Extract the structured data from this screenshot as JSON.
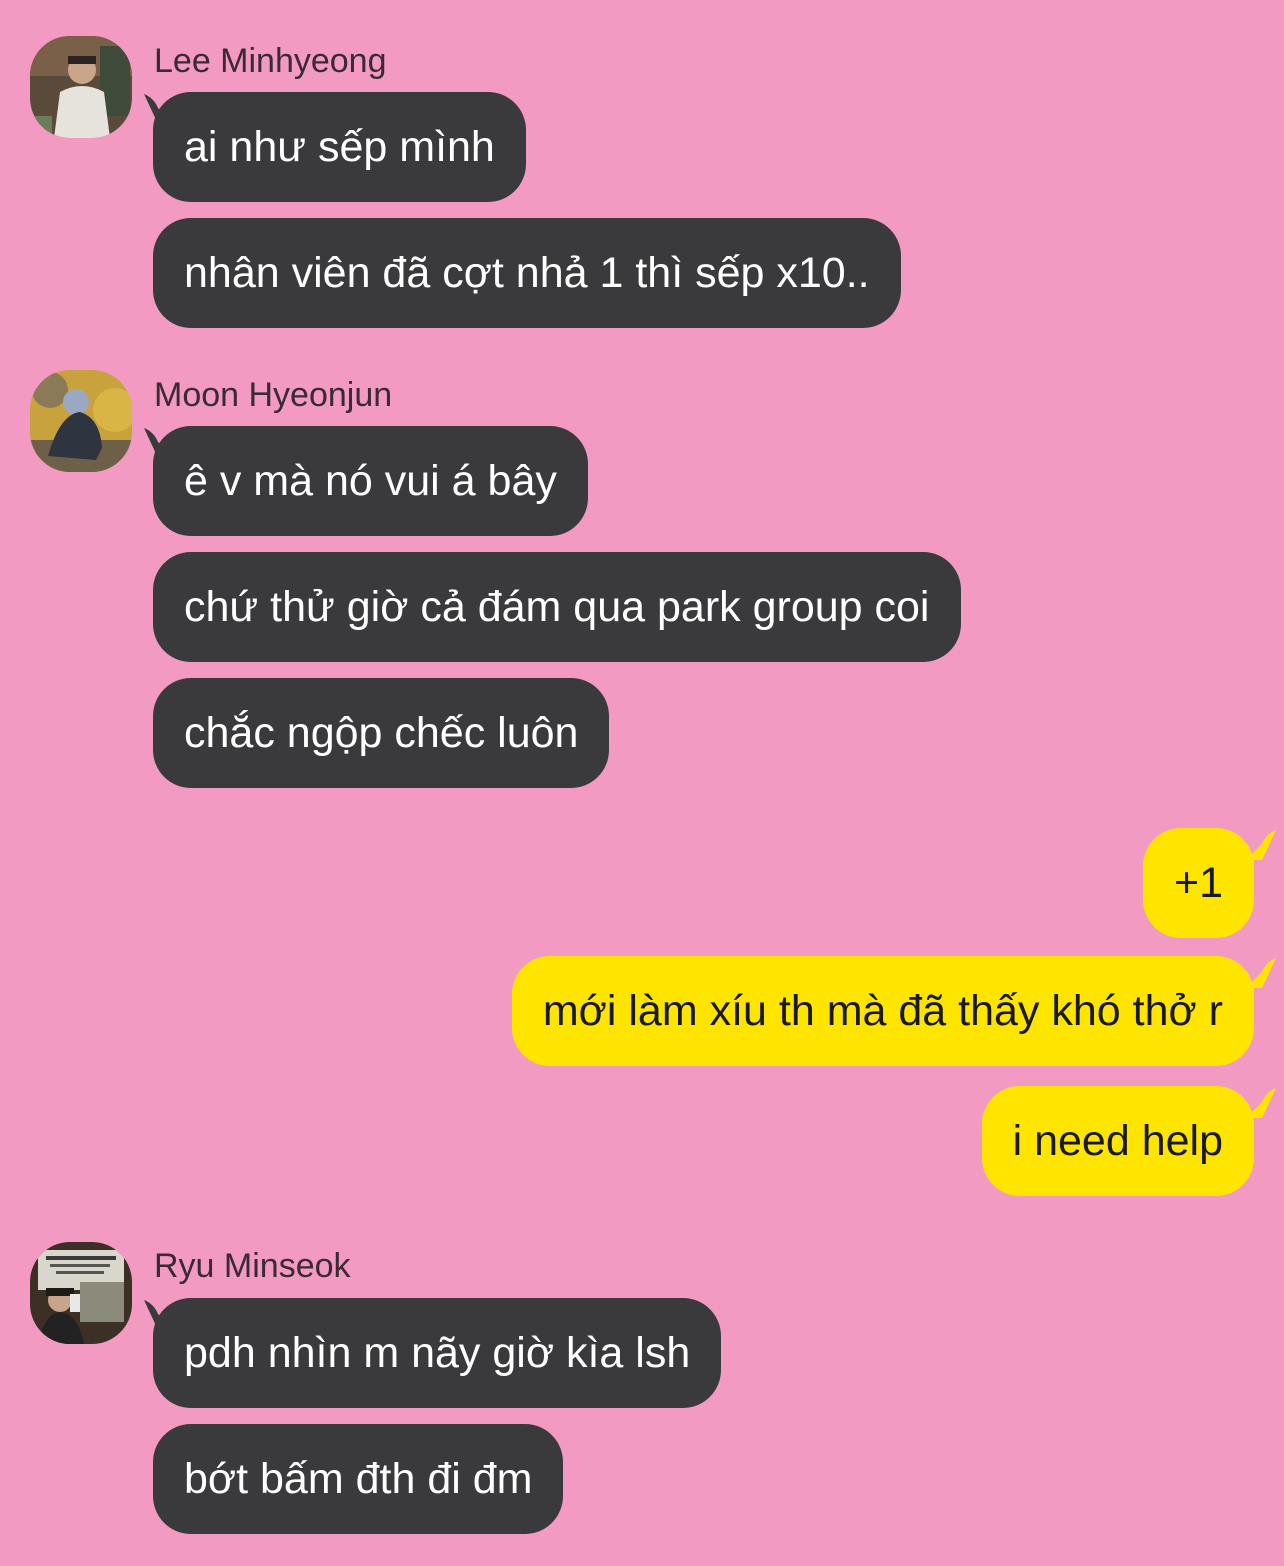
{
  "theme": {
    "background": "#f29ac1",
    "incoming_bubble": "#3a3a3c",
    "outgoing_bubble": "#fee500"
  },
  "groups": [
    {
      "sender": "Lee Minhyeong",
      "avatar": "user-photo-avatar",
      "messages": [
        "ai như sếp mình",
        "nhân viên đã cợt nhả 1 thì sếp x10.."
      ]
    },
    {
      "sender": "Moon Hyeonjun",
      "avatar": "user-photo-avatar",
      "messages": [
        "ê v mà nó vui á bây",
        "chứ thử giờ cả đám qua park group coi",
        "chắc ngộp chếc luôn"
      ]
    },
    {
      "sender": "me",
      "messages": [
        "+1",
        "mới làm xíu th mà đã thấy khó thở r",
        "i need help"
      ]
    },
    {
      "sender": "Ryu Minseok",
      "avatar": "user-photo-avatar",
      "messages": [
        "pdh nhìn m nãy giờ kìa lsh",
        "bớt bấm đth đi đm"
      ]
    }
  ]
}
